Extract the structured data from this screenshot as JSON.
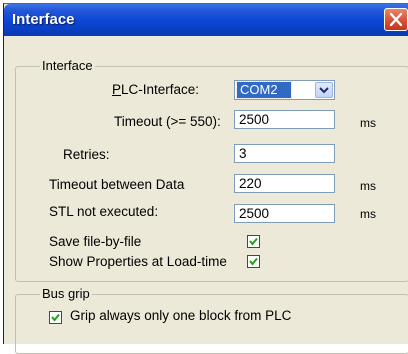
{
  "window": {
    "title": "Interface"
  },
  "interface_group": {
    "legend": "Interface",
    "plc_interface_label": "PLC-Interface:",
    "plc_interface_access_key": "P",
    "plc_interface_value": "COM2",
    "timeout_label": "Timeout (>= 550):",
    "timeout_value": "2500",
    "timeout_unit": "ms",
    "retries_label": "Retries:",
    "retries_value": "3",
    "timeout_between_data_label": "Timeout between Data",
    "timeout_between_data_value": "220",
    "timeout_between_data_unit": "ms",
    "stl_not_executed_label": "STL not executed:",
    "stl_not_executed_value": "2500",
    "stl_not_executed_unit": "ms",
    "save_file_by_file_label": "Save file-by-file",
    "save_file_by_file_checked": true,
    "show_properties_label": "Show Properties at Load-time",
    "show_properties_checked": true
  },
  "bus_grip_group": {
    "legend": "Bus grip",
    "grip_option_label": "Grip always only one block from PLC",
    "grip_option_checked": true
  },
  "colors": {
    "titlebar": "#0a47d6",
    "dialog_background": "#ece9d8",
    "selection": "#316ac5",
    "close_button": "#d9553a"
  }
}
